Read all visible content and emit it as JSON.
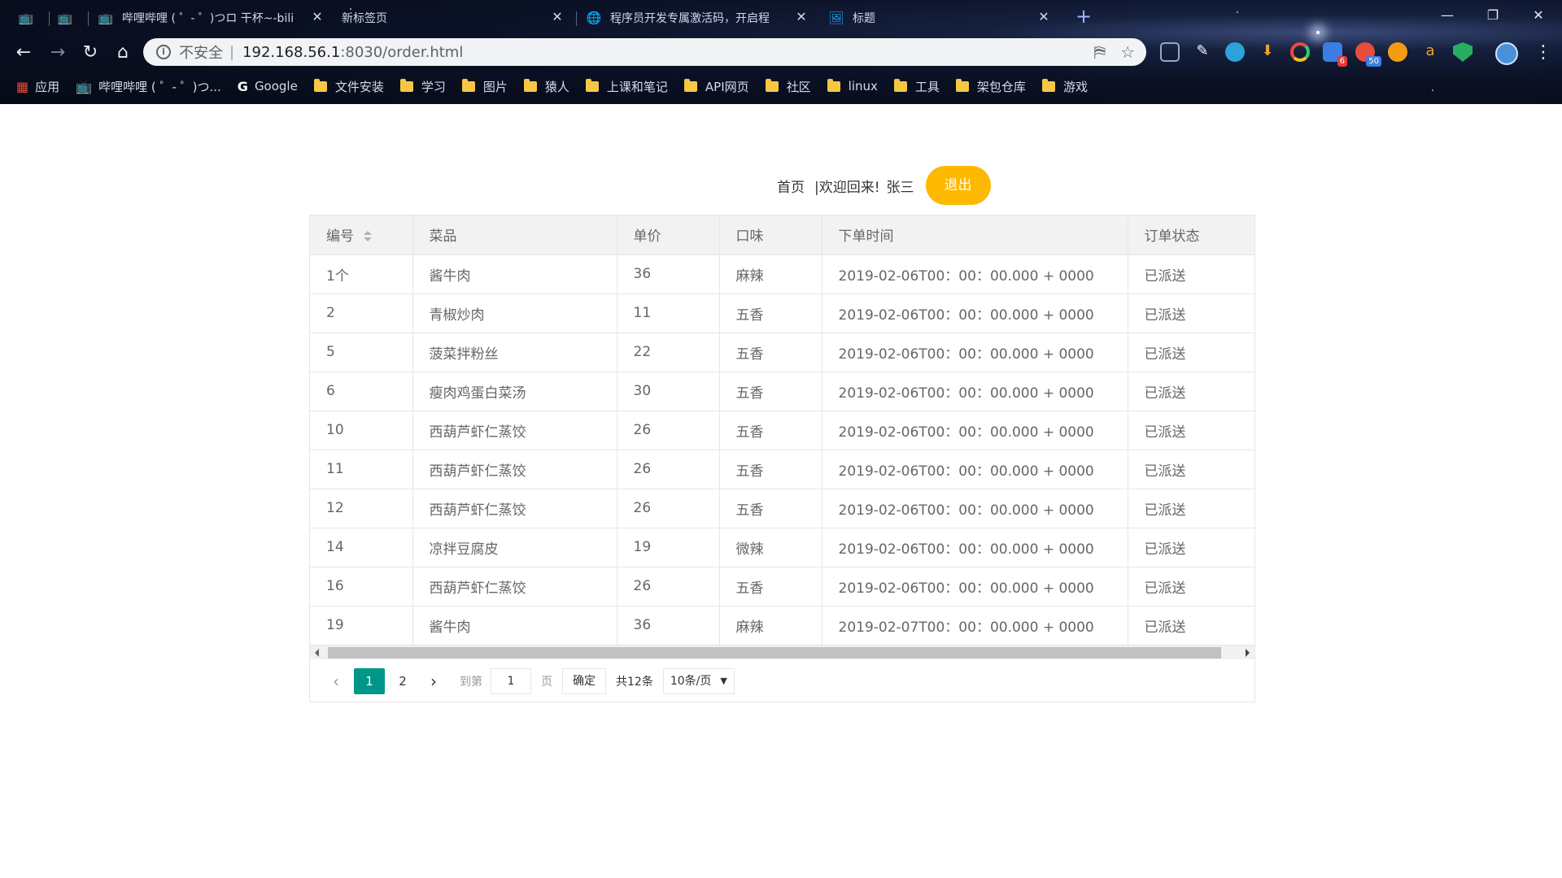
{
  "browser": {
    "tabs": [
      {
        "title": "",
        "icon": "bilibili-icon"
      },
      {
        "title": "",
        "icon": "bilibili-icon"
      },
      {
        "title": "哔哩哔哩 ( ゜- ゜)つロ 干杯~-bili",
        "icon": "bilibili-icon"
      },
      {
        "title": "新标签页",
        "icon": ""
      },
      {
        "title": "程序员开发专属激活码，开启程",
        "icon": "globe-icon"
      },
      {
        "title": "标题",
        "icon": "page-icon"
      }
    ],
    "address": {
      "insecure_label": "不安全",
      "separator": "|",
      "host": "192.168.56.1",
      "path": ":8030/order.html"
    },
    "extension_badges": [
      "6",
      "50"
    ],
    "bookmarks": [
      {
        "label": "应用",
        "icon": "apps-icon"
      },
      {
        "label": "哔哩哔哩 ( ゜- ゜)つ...",
        "icon": "bilibili-icon"
      },
      {
        "label": "Google",
        "icon": "google-icon"
      },
      {
        "label": "文件安装",
        "icon": "folder-icon"
      },
      {
        "label": "学习",
        "icon": "folder-icon"
      },
      {
        "label": "图片",
        "icon": "folder-icon"
      },
      {
        "label": "猿人",
        "icon": "folder-icon"
      },
      {
        "label": "上课和笔记",
        "icon": "folder-icon"
      },
      {
        "label": "API网页",
        "icon": "folder-icon"
      },
      {
        "label": "社区",
        "icon": "folder-icon"
      },
      {
        "label": "linux",
        "icon": "folder-icon"
      },
      {
        "label": "工具",
        "icon": "folder-icon"
      },
      {
        "label": "架包仓库",
        "icon": "folder-icon"
      },
      {
        "label": "游戏",
        "icon": "folder-icon"
      }
    ]
  },
  "nav": {
    "home": "首页",
    "welcome": "|欢迎回来!",
    "user": "张三",
    "logout": "退出"
  },
  "table": {
    "columns": [
      "编号",
      "菜品",
      "单价",
      "口味",
      "下单时间",
      "订单状态"
    ],
    "rows": [
      [
        "1个",
        "酱牛肉",
        "36",
        "麻辣",
        "2019-02-06T00：00：00.000 + 0000",
        "已派送"
      ],
      [
        "2",
        "青椒炒肉",
        "11",
        "五香",
        "2019-02-06T00：00：00.000 + 0000",
        "已派送"
      ],
      [
        "5",
        "菠菜拌粉丝",
        "22",
        "五香",
        "2019-02-06T00：00：00.000 + 0000",
        "已派送"
      ],
      [
        "6",
        "瘦肉鸡蛋白菜汤",
        "30",
        "五香",
        "2019-02-06T00：00：00.000 + 0000",
        "已派送"
      ],
      [
        "10",
        "西葫芦虾仁蒸饺",
        "26",
        "五香",
        "2019-02-06T00：00：00.000 + 0000",
        "已派送"
      ],
      [
        "11",
        "西葫芦虾仁蒸饺",
        "26",
        "五香",
        "2019-02-06T00：00：00.000 + 0000",
        "已派送"
      ],
      [
        "12",
        "西葫芦虾仁蒸饺",
        "26",
        "五香",
        "2019-02-06T00：00：00.000 + 0000",
        "已派送"
      ],
      [
        "14",
        "凉拌豆腐皮",
        "19",
        "微辣",
        "2019-02-06T00：00：00.000 + 0000",
        "已派送"
      ],
      [
        "16",
        "西葫芦虾仁蒸饺",
        "26",
        "五香",
        "2019-02-06T00：00：00.000 + 0000",
        "已派送"
      ],
      [
        "19",
        "酱牛肉",
        "36",
        "麻辣",
        "2019-02-07T00：00：00.000 + 0000",
        "已派送"
      ]
    ]
  },
  "pager": {
    "pages": [
      "1",
      "2"
    ],
    "current": "1",
    "goto_label": "到第",
    "goto_value": "1",
    "page_label": "页",
    "confirm": "确定",
    "total": "共12条",
    "limit": "10条/页"
  },
  "colors": {
    "logout_button": "#ffb800",
    "current_page": "#009688",
    "header_bg": "#f2f2f2",
    "border": "#e6e6e6"
  }
}
